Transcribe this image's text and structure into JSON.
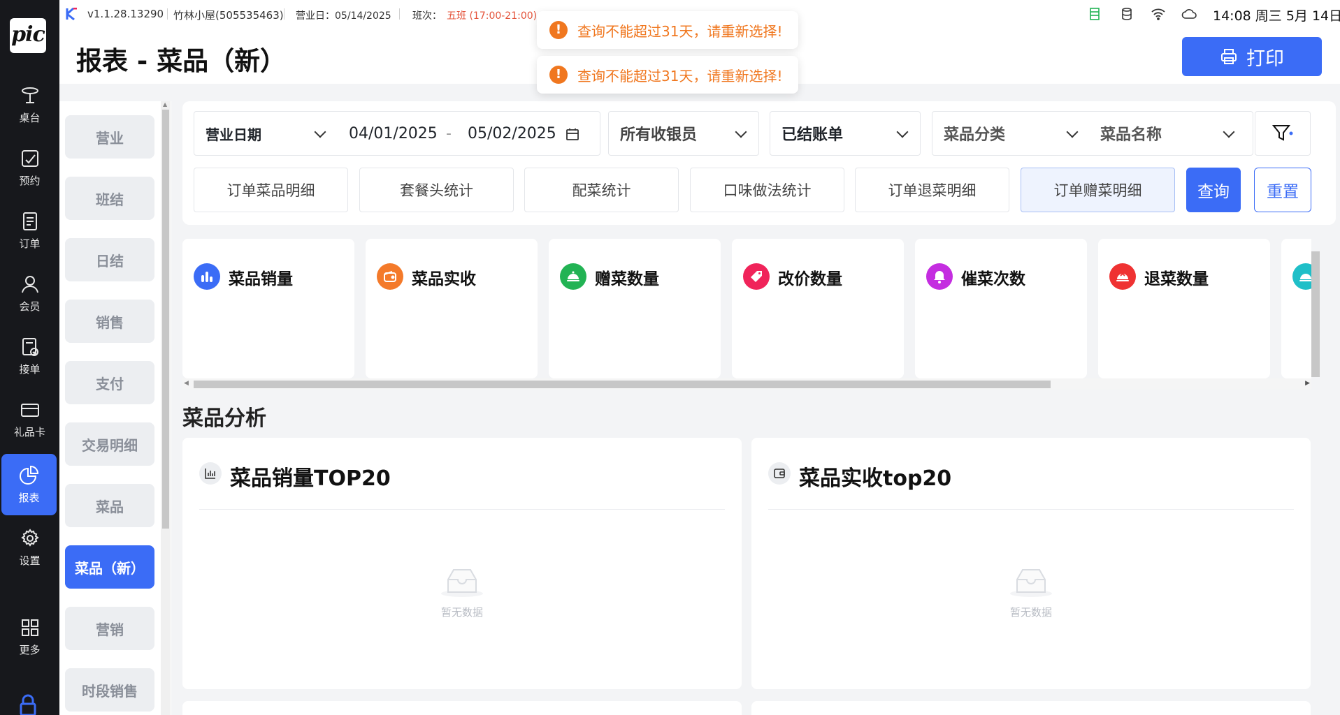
{
  "leftnav": {
    "logo": "pic",
    "items": [
      {
        "label": "桌台",
        "icon": "table-icon"
      },
      {
        "label": "预约",
        "icon": "reservation-icon"
      },
      {
        "label": "订单",
        "icon": "order-icon"
      },
      {
        "label": "会员",
        "icon": "member-icon"
      },
      {
        "label": "接单",
        "icon": "accept-order-icon"
      },
      {
        "label": "礼品卡",
        "icon": "gift-card-icon"
      },
      {
        "label": "报表",
        "icon": "report-icon",
        "active": true
      },
      {
        "label": "设置",
        "icon": "settings-icon"
      },
      {
        "label": "更多",
        "icon": "more-icon"
      }
    ]
  },
  "statusbar": {
    "version": "v1.1.28.13290",
    "store": "竹林小屋(505535463)",
    "business_day": "营业日：05/14/2025",
    "shift_label": "班次：",
    "shift_value": "五班 (17:00-21:00)",
    "clock": "14:08 周三 5月 14日"
  },
  "header": {
    "title": "报表 - 菜品（新）",
    "print_label": "打印"
  },
  "toasts": [
    {
      "text": "查询不能超过31天，请重新选择!"
    },
    {
      "text": "查询不能超过31天，请重新选择!"
    }
  ],
  "subnav": {
    "items": [
      {
        "label": "营业"
      },
      {
        "label": "班结"
      },
      {
        "label": "日结"
      },
      {
        "label": "销售"
      },
      {
        "label": "支付"
      },
      {
        "label": "交易明细"
      },
      {
        "label": "菜品"
      },
      {
        "label": "菜品（新）",
        "active": true
      },
      {
        "label": "营销"
      },
      {
        "label": "时段销售"
      }
    ]
  },
  "filters": {
    "date_type": "营业日期",
    "date_start": "04/01/2025",
    "date_sep": "-",
    "date_end": "05/02/2025",
    "cashier": "所有收银员",
    "bill_status": "已结账单",
    "dish_category": "菜品分类",
    "dish_name": "菜品名称"
  },
  "tabs": [
    {
      "label": "订单菜品明细"
    },
    {
      "label": "套餐头统计"
    },
    {
      "label": "配菜统计"
    },
    {
      "label": "口味做法统计"
    },
    {
      "label": "订单退菜明细"
    },
    {
      "label": "订单赠菜明细",
      "active": true
    }
  ],
  "actions": {
    "query": "查询",
    "reset": "重置"
  },
  "metrics": [
    {
      "label": "菜品销量",
      "icon": "sales-volume-icon",
      "color": "#3b6cf6"
    },
    {
      "label": "菜品实收",
      "icon": "wallet-icon",
      "color": "#f47a2a"
    },
    {
      "label": "赠菜数量",
      "icon": "gift-dish-icon",
      "color": "#22b354"
    },
    {
      "label": "改价数量",
      "icon": "price-tag-icon",
      "color": "#f0245a"
    },
    {
      "label": "催菜次数",
      "icon": "bell-icon",
      "color": "#c42de0"
    },
    {
      "label": "退菜数量",
      "icon": "return-dish-icon",
      "color": "#ef3232"
    },
    {
      "label": "",
      "icon": "partial-icon",
      "color": "#1fbfc8"
    }
  ],
  "analysis": {
    "section_title": "菜品分析",
    "cards": [
      {
        "title": "菜品销量TOP20",
        "icon": "bar-chart-icon",
        "empty_text": "暂无数据"
      },
      {
        "title": "菜品实收top20",
        "icon": "wallet-outline-icon",
        "empty_text": "暂无数据"
      }
    ]
  }
}
